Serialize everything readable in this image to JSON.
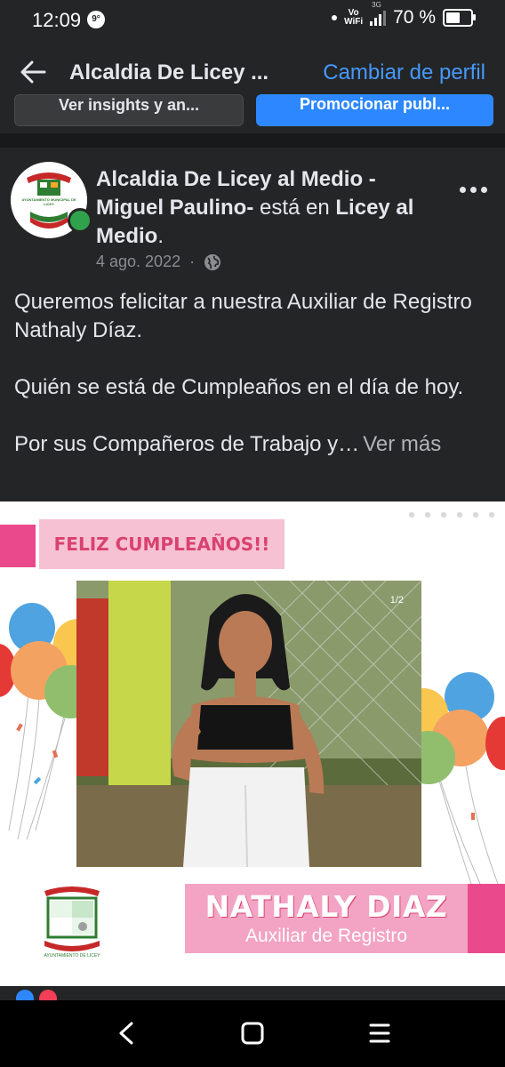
{
  "status_bar": {
    "time": "12:09",
    "notification_badge": "9°",
    "network_top": "Vo",
    "network_bottom": "WiFi",
    "network_type": "3G",
    "battery": "70 %",
    "battery_level": 0.7
  },
  "header": {
    "title": "Alcaldia De Licey ...",
    "switch_profile": "Cambiar de perfil"
  },
  "peek_buttons": {
    "insights": "Ver insights y an...",
    "promote": "Promocionar publ..."
  },
  "post": {
    "author_name": "Alcaldia De Licey al Medio - Miguel Paulino-",
    "author_connector": " está en ",
    "location": "Licey al Medio",
    "location_end": ".",
    "date": "4 ago. 2022",
    "meta_separator": "·",
    "text_p1": "Queremos felicitar a nuestra Auxiliar de Registro Nathaly Díaz.",
    "text_p2": "Quién se está de Cumpleaños en el día de hoy.",
    "text_p3": "Por sus Compañeros de Trabajo y…",
    "see_more": "Ver más"
  },
  "photo": {
    "banner_text": "FELIZ CUMPLEAÑOS!!",
    "counter": "1/2",
    "name": "NATHALY DIAZ",
    "role": "Auxiliar de Registro",
    "logo_text": "AYUNTAMIENTO DE LICEY"
  },
  "avatar_logo_text": "AYUNTAMIENTO MUNICIPAL DE LICEY",
  "colors": {
    "background": "#242526",
    "link_blue": "#4599ff",
    "promote_blue": "#2d88ff",
    "online_green": "#31a24c",
    "pink": "#ea4a8c",
    "light_pink": "#f3a3c3"
  }
}
